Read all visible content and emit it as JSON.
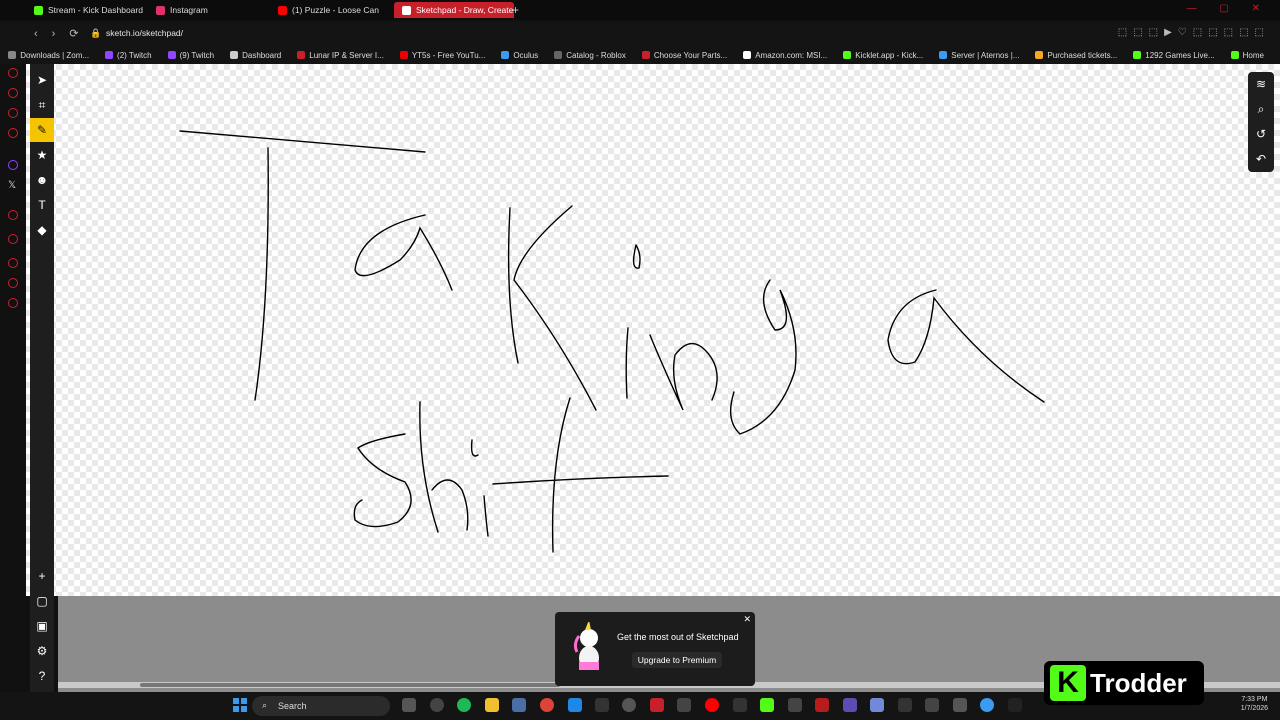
{
  "browser": {
    "tabs": [
      {
        "label": "Stream - Kick Dashboard",
        "fav": "#53fc18"
      },
      {
        "label": "Instagram",
        "fav": "#e1306c"
      },
      {
        "label": "(1) Puzzle - Loose Can",
        "fav": "#ff0000"
      },
      {
        "label": "Sketchpad - Draw, Create,",
        "fav": "#c8202b",
        "active": true
      }
    ],
    "address": "sketch.io/sketchpad/",
    "bookmarks": [
      "Downloads | Zom...",
      "(2) Twitch",
      "(9) Twitch",
      "Dashboard",
      "Lunar IP & Server I...",
      "YT5s - Free YouTu...",
      "Oculus",
      "Catalog - Roblox",
      "Choose Your Parts...",
      "Amazon.com: MSI...",
      "Kicklet.app - Kick...",
      "Server | Aternos |...",
      "Purchased tickets...",
      "1292 Games Live...",
      "Home"
    ]
  },
  "toolbar": {
    "tools": [
      {
        "name": "select-tool",
        "glyph": "➤"
      },
      {
        "name": "crop-tool",
        "glyph": "⌗"
      },
      {
        "name": "pencil-tool",
        "glyph": "✎",
        "selected": true
      },
      {
        "name": "star-tool",
        "glyph": "★"
      },
      {
        "name": "emoji-tool",
        "glyph": "☻"
      },
      {
        "name": "text-tool",
        "glyph": "T"
      },
      {
        "name": "fill-tool",
        "glyph": "◆"
      }
    ],
    "bottom_tools": [
      {
        "name": "add-tool",
        "glyph": "+"
      },
      {
        "name": "new-page-tool",
        "glyph": "▢"
      },
      {
        "name": "save-tool",
        "glyph": "▣"
      },
      {
        "name": "settings-tool",
        "glyph": "⚙"
      },
      {
        "name": "help-tool",
        "glyph": "?"
      }
    ],
    "right_tools": [
      {
        "name": "layers-tool",
        "glyph": "≋"
      },
      {
        "name": "zoom-tool",
        "glyph": "⌕"
      },
      {
        "name": "history-tool",
        "glyph": "↺"
      },
      {
        "name": "undo-tool",
        "glyph": "↶"
      }
    ]
  },
  "promo": {
    "text": "Get the most out of Sketchpad",
    "button": "Upgrade to Premium"
  },
  "taskbar": {
    "search_placeholder": "Search",
    "time": "7:33 PM",
    "date": "1/7/2026"
  },
  "overlay": {
    "brand_letter": "K",
    "name": "Trodder"
  }
}
